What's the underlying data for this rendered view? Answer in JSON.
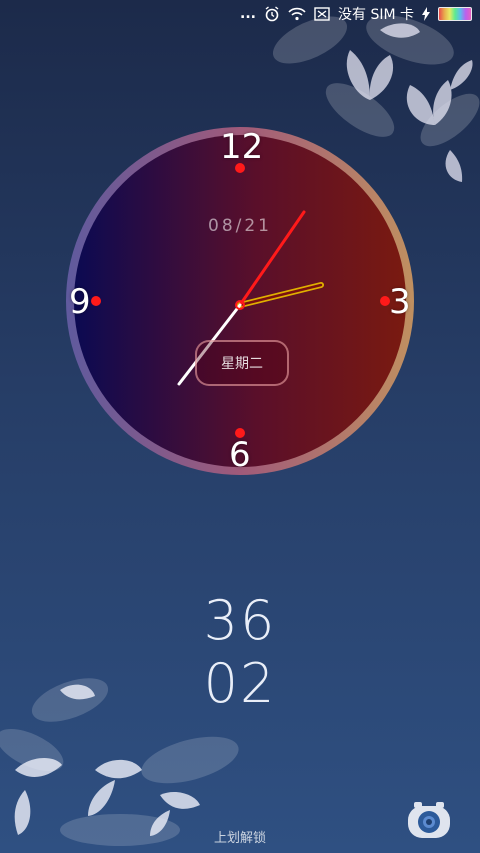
{
  "status_bar": {
    "dots": "...",
    "sim_text": "没有 SIM 卡",
    "icons": [
      "alarm-icon",
      "wifi-icon",
      "no-sim-icon",
      "charging-icon",
      "battery-icon"
    ]
  },
  "clock": {
    "date": "08/21",
    "weekday": "星期二",
    "numbers": {
      "twelve": "12",
      "three": "3",
      "six": "6",
      "nine": "9"
    },
    "colors": {
      "face_left": "#0b0a52",
      "face_right": "#7a1010",
      "marker": "#ff1a1a",
      "hour_hand": "#e0b000",
      "minute_hand": "#ff1a1a",
      "second_hand": "#ffffff"
    }
  },
  "lock_time": {
    "line1": "36",
    "line2": "02"
  },
  "unlock_hint": "上划解锁"
}
